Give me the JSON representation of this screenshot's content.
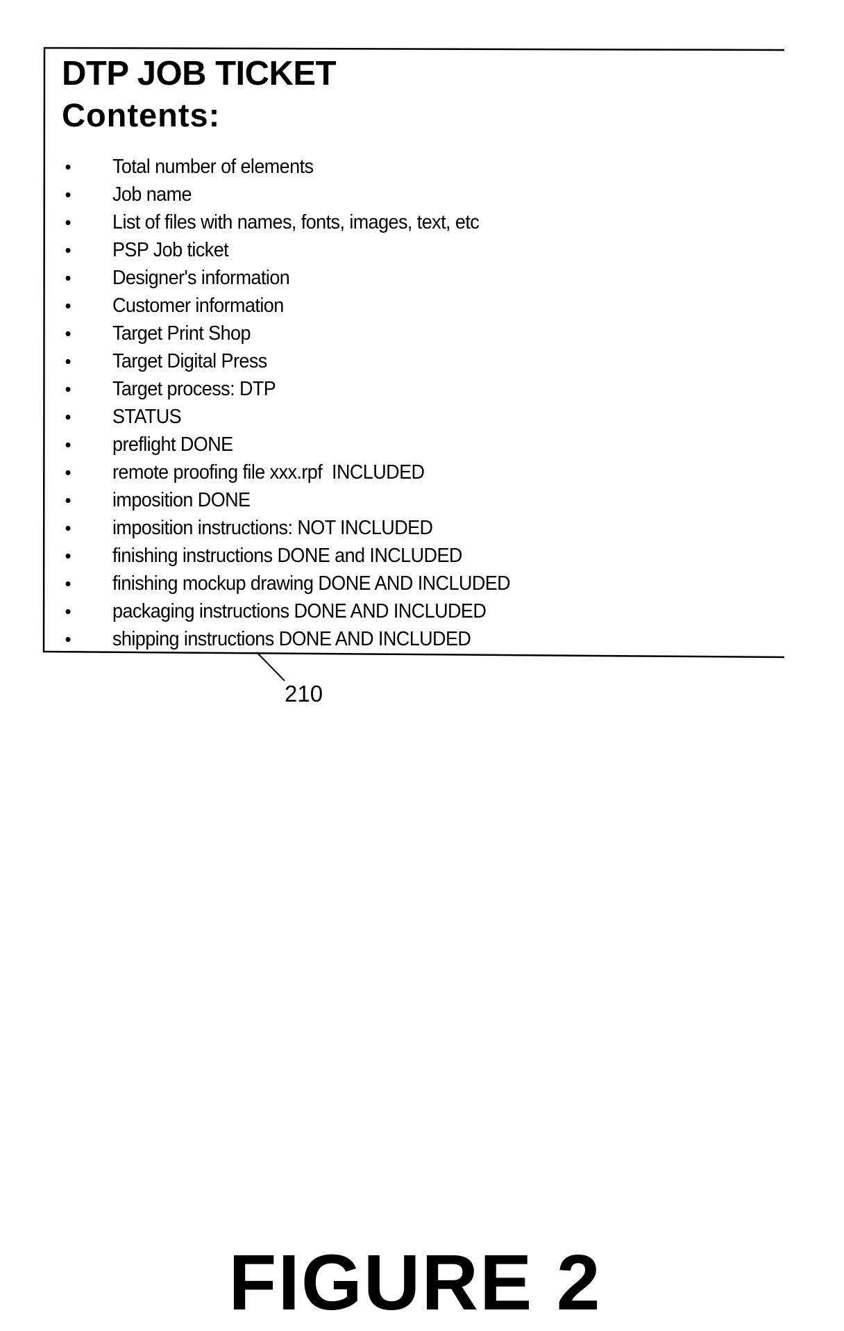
{
  "ticket": {
    "title": "DTP JOB TICKET",
    "subtitle": "Contents:",
    "bullet_glyph": "•",
    "items": [
      "Total number of elements",
      "Job name",
      "List of files with names, fonts, images, text, etc",
      "PSP Job ticket",
      "Designer's information",
      "Customer information",
      "Target Print Shop",
      "Target Digital Press",
      "Target process: DTP",
      "STATUS",
      "preflight DONE",
      "remote proofing file xxx.rpf  INCLUDED",
      "imposition DONE",
      "imposition instructions: NOT INCLUDED",
      "finishing instructions DONE and INCLUDED",
      "finishing mockup drawing DONE AND INCLUDED",
      "packaging instructions DONE AND INCLUDED",
      "shipping instructions DONE AND INCLUDED"
    ]
  },
  "reference_numeral": "210",
  "figure_caption": "FIGURE 2"
}
